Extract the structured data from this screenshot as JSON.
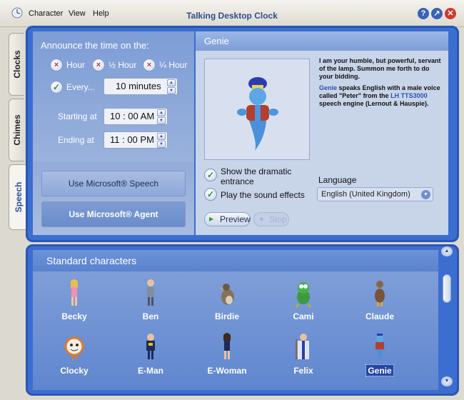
{
  "window": {
    "title": "Talking Desktop Clock",
    "menu": [
      "Character",
      "View",
      "Help"
    ],
    "buttons": {
      "help": "?",
      "minimize": "↗",
      "close": "✕"
    }
  },
  "tabs": [
    {
      "label": "Clocks"
    },
    {
      "label": "Chimes"
    },
    {
      "label": "Speech"
    }
  ],
  "left": {
    "announce_label": "Announce the time on the:",
    "options": [
      "Hour",
      "½ Hour",
      "¼ Hour"
    ],
    "every_label": "Every...",
    "every_value": "10 minutes",
    "starting_label": "Starting at",
    "starting_value": "10 : 00 AM",
    "ending_label": "Ending at",
    "ending_value": "11 : 00 PM",
    "speech_button": "Use Microsoft® Speech",
    "agent_button": "Use Microsoft® Agent"
  },
  "right": {
    "character_name": "Genie",
    "quote": "I am your humble, but powerful, servant of the lamp. Summon me forth to do your bidding.",
    "desc_name": "Genie",
    "desc_mid": " speaks English with a male voice called \"Peter\" from the ",
    "desc_engine": "LH TTS3000",
    "desc_end": " speech engine (Lernout & Hauspie).",
    "dramatic_label": "Show the dramatic entrance",
    "sound_label": "Play the sound effects",
    "language_label": "Language",
    "language_value": "English (United Kingdom)",
    "preview_label": "Preview",
    "stop_label": "Stop"
  },
  "characters": {
    "heading": "Standard characters",
    "row1": [
      "Becky",
      "Ben",
      "Birdie",
      "Cami",
      "Claude"
    ],
    "row2": [
      "Clocky",
      "E-Man",
      "E-Woman",
      "Felix",
      "Genie"
    ],
    "selected": "Genie"
  }
}
